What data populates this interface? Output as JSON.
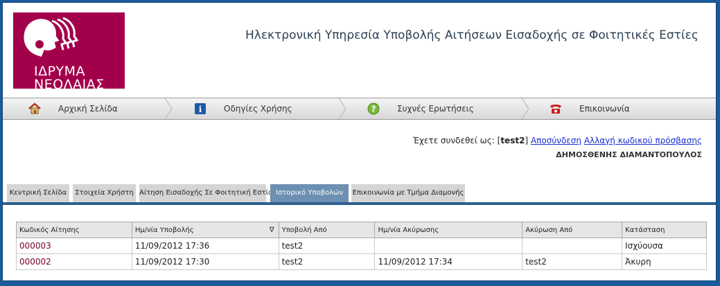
{
  "header": {
    "logo_line1": "ΙΔΡΥΜΑ",
    "logo_line2": "ΝΕΟΛΑΙΑΣ",
    "site_title": "Ηλεκτρονική Υπηρεσία Υποβολής Αιτήσεων Εισαδοχής σε Φοιτητικές Εστίες"
  },
  "menu": {
    "items": [
      {
        "label": "Αρχική Σελίδα",
        "icon": "home-icon"
      },
      {
        "label": "Οδηγίες Χρήσης",
        "icon": "info-icon"
      },
      {
        "label": "Συχνές Ερωτήσεις",
        "icon": "help-icon"
      },
      {
        "label": "Επικοινωνία",
        "icon": "phone-icon"
      }
    ]
  },
  "session": {
    "prefix": "Έχετε συνδεθεί ως: [",
    "username": "test2",
    "suffix": "]",
    "logout": "Αποσύνδεση",
    "change_password": "Αλλαγή κωδικού πρόσβασης",
    "full_name": "ΔΗΜΟΣΘΕΝΗΣ ΔΙΑΜΑΝΤΟΠΟΥΛΟΣ"
  },
  "tabs": [
    "Κεντρική Σελίδα",
    "Στοιχεία Χρήστη",
    "Αίτηση Εισαδοχής Σε Φοιτητική Εστία",
    "Ιστορικό Υποβολών",
    "Επικοινωνία με Τμήμα Διαμονής"
  ],
  "active_tab": 3,
  "table": {
    "headers": [
      "Κωδικός Αίτησης",
      "Ημ/νία Υποβολής",
      "Υποβολή Από",
      "Ημ/νία Ακύρωσης",
      "Ακύρωση Από",
      "Κατάσταση"
    ],
    "sort_indicator": "∇",
    "rows": [
      [
        "000003",
        "11/09/2012 17:36",
        "test2",
        "",
        "",
        "Ισχύουσα"
      ],
      [
        "000002",
        "11/09/2012 17:30",
        "test2",
        "11/09/2012 17:34",
        "test2",
        "Άκυρη"
      ]
    ]
  },
  "colors": {
    "brand": "#a3004c",
    "tab_active": "#6c8fb2",
    "frame": "#1a5b9c"
  }
}
